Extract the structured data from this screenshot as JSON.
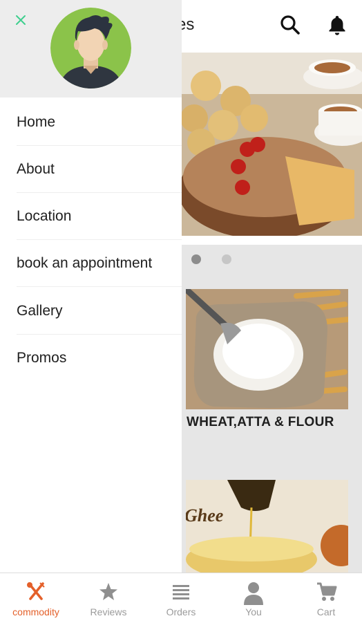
{
  "header": {
    "title_fragment": "es"
  },
  "drawer": {
    "menu": [
      {
        "label": "Home"
      },
      {
        "label": "About"
      },
      {
        "label": "Location"
      },
      {
        "label": "book an appointment"
      },
      {
        "label": "Gallery"
      },
      {
        "label": "Promos"
      }
    ]
  },
  "carousel": {
    "page_count": 2,
    "active_index": 0
  },
  "categories": [
    {
      "label": "WHEAT,ATTA & FLOUR"
    },
    {
      "label": ""
    }
  ],
  "bottom_nav": {
    "active_index": 0,
    "items": [
      {
        "label": "commodity",
        "icon": "fork-spoon-icon"
      },
      {
        "label": "Reviews",
        "icon": "star-icon"
      },
      {
        "label": "Orders",
        "icon": "list-icon"
      },
      {
        "label": "You",
        "icon": "person-icon"
      },
      {
        "label": "Cart",
        "icon": "cart-icon"
      }
    ]
  },
  "colors": {
    "accent": "#e4602a",
    "close": "#3ecf8e",
    "avatar_bg": "#8bc34a"
  }
}
